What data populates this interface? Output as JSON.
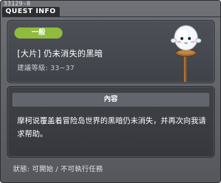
{
  "window": {
    "quest_id": "33129-0",
    "title": "QUEST INFO"
  },
  "quest": {
    "category_badge": "一般",
    "name": "[大片] 仍未消失的黑暗",
    "level_label": "建議等級:",
    "level_range": "33~37",
    "mascot_icon": "snowman-signpost-icon"
  },
  "content": {
    "header": "內容",
    "text": "摩柯说覆盖着冒险岛世界的黑暗仍未消失，并再次向我请求帮助。"
  },
  "status": {
    "label": "狀態:",
    "value": "可開始 / 不可執行任務"
  },
  "colors": {
    "badge_green": "#8fbc3c",
    "panel": "#3f4248",
    "window": "#606268"
  }
}
